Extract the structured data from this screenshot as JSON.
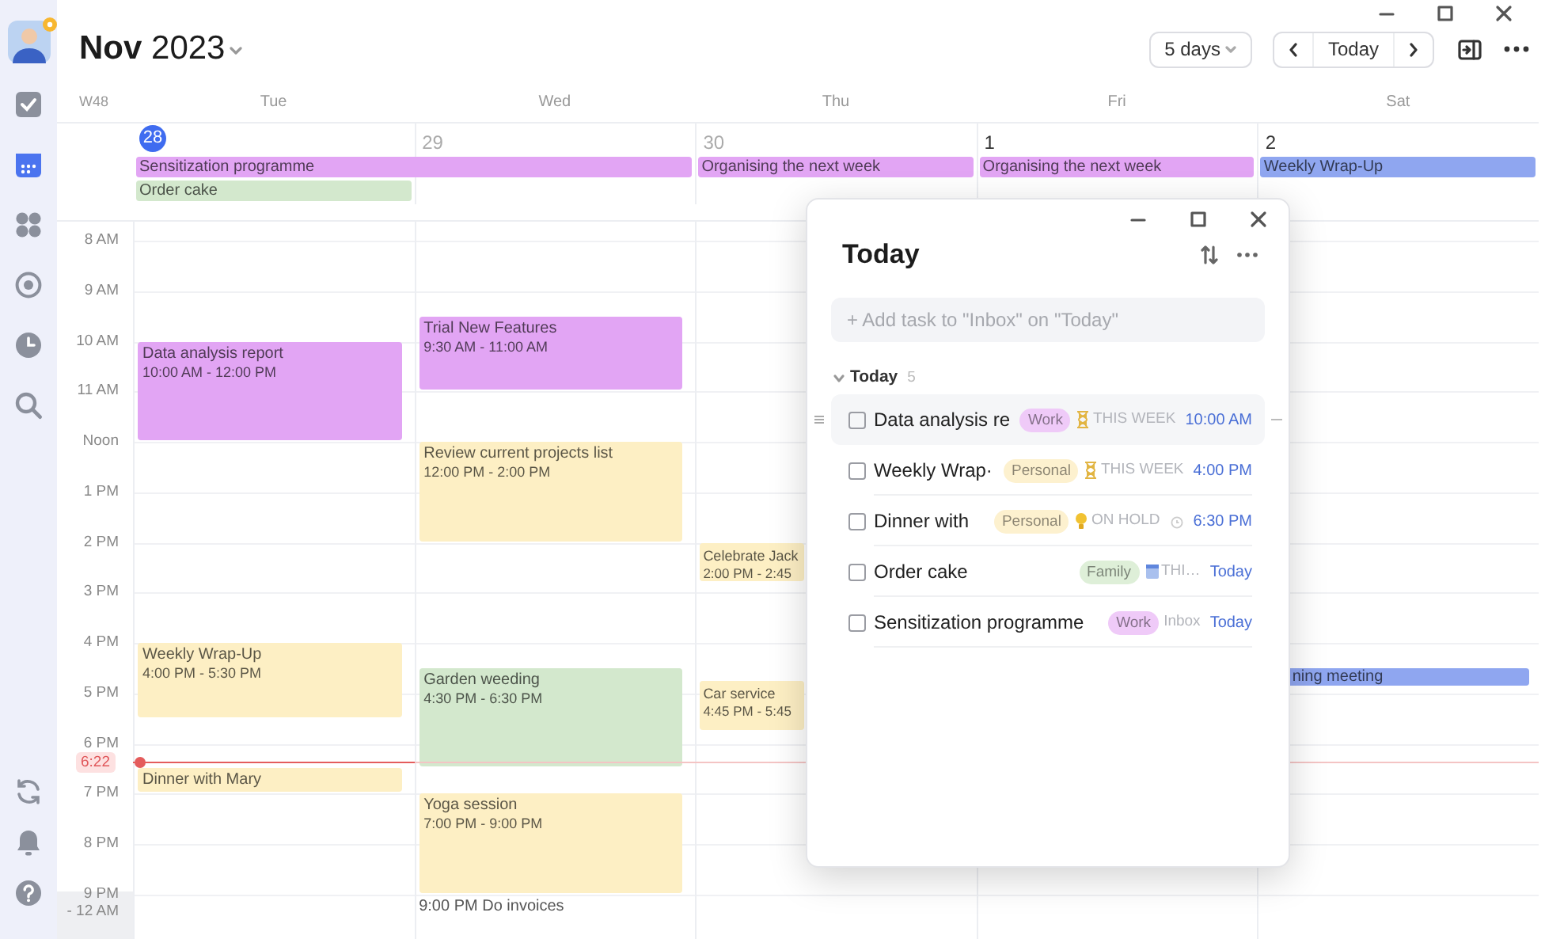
{
  "header": {
    "title": "**Nov** 2023",
    "view": "5 days",
    "today_button": "Today"
  },
  "sidebar": {
    "items": [
      {
        "kind": "tasks",
        "selected": false
      },
      {
        "kind": "calendar",
        "selected": true
      },
      {
        "kind": "apps",
        "selected": false
      },
      {
        "kind": "focus",
        "selected": false
      },
      {
        "kind": "clock",
        "selected": false
      },
      {
        "kind": "search",
        "selected": false
      }
    ],
    "footer": [
      {
        "kind": "sync"
      },
      {
        "kind": "bell"
      },
      {
        "kind": "help"
      }
    ]
  },
  "week_label": "W48",
  "days": [
    {
      "weekday": "Tue",
      "date": "28",
      "today": true,
      "dimmed": false,
      "events": [
        {
          "kind": "block",
          "title": "Data analysis report",
          "time": "10:00 AM - 12:00 PM",
          "color": "#e2a5f4"
        },
        {
          "kind": "block",
          "title": "Weekly Wrap-Up",
          "time": "4:00 PM - 5:30 PM",
          "color": "#fdefc4"
        },
        {
          "kind": "block",
          "title": "Dinner with Mary",
          "color": "#fdefc4"
        }
      ]
    },
    {
      "weekday": "Wed",
      "date": "29",
      "today": false,
      "dimmed": true,
      "events": [
        {
          "kind": "block",
          "title": "Trial New Features",
          "time": "9:30 AM - 11:00 AM",
          "color": "#e2a5f4"
        },
        {
          "kind": "block",
          "title": "Review current projects list",
          "time": "12:00 PM - 2:00 PM",
          "color": "#fdefc4"
        },
        {
          "kind": "block",
          "title": "Garden weeding",
          "time": "4:30 PM - 6:30 PM",
          "color": "#d3e8cd"
        },
        {
          "kind": "block",
          "title": "Yoga session",
          "time": "7:00 PM - 9:00 PM",
          "color": "#fdefc4"
        },
        {
          "kind": "text",
          "title": "9:00 PM Do invoices"
        }
      ]
    },
    {
      "weekday": "Thu",
      "date": "30",
      "today": false,
      "dimmed": true,
      "events": [
        {
          "kind": "block",
          "title": "Celebrate Jack",
          "time": "2:00 PM - 2:45",
          "color": "#fdefc4"
        },
        {
          "kind": "block",
          "title": "Car service",
          "time": "4:45 PM - 5:45",
          "color": "#fdefc4"
        }
      ]
    },
    {
      "weekday": "Fri",
      "date": "1",
      "today": false,
      "dimmed": false
    },
    {
      "weekday": "Sat",
      "date": "2",
      "today": false,
      "dimmed": false,
      "events": [
        {
          "kind": "bar",
          "title": "ning meeting",
          "color": "#8fa6f0"
        }
      ]
    }
  ],
  "all_day": [
    {
      "title": "Sensitization programme",
      "color": "#e2a5f4"
    },
    {
      "title": "Order cake",
      "color": "#d3e8cd"
    },
    {
      "title": "Organising the next week",
      "color": "#e2a5f4"
    },
    {
      "title": "Organising the next week",
      "color": "#e2a5f4"
    },
    {
      "title": "Weekly Wrap-Up",
      "color": "#8fa6f0"
    }
  ],
  "hours": [
    "8 AM",
    "9 AM",
    "10 AM",
    "11 AM",
    "Noon",
    "1 PM",
    "2 PM",
    "3 PM",
    "4 PM",
    "5 PM",
    "6 PM",
    "7 PM",
    "8 PM",
    "9 PM\n- 12 AM"
  ],
  "now": "6:22",
  "today_panel": {
    "title": "Today",
    "add_placeholder": "+ Add task to \"Inbox\" on \"Today\"",
    "section": {
      "title": "Today",
      "count": "5",
      "expanded": true
    },
    "tasks": [
      {
        "title": "Data analysis re",
        "checked": false,
        "hovered": true,
        "tag": {
          "label": "Work",
          "color": "#efcaf8"
        },
        "meta": {
          "kind": "hourglass",
          "label": "THIS WEEK"
        },
        "reminder": false,
        "due": "10:00 AM"
      },
      {
        "title": "Weekly Wrap·",
        "checked": false,
        "hovered": false,
        "tag": {
          "label": "Personal",
          "color": "#fdf1cf"
        },
        "meta": {
          "kind": "hourglass",
          "label": "THIS WEEK"
        },
        "reminder": false,
        "due": "4:00 PM"
      },
      {
        "title": "Dinner with",
        "checked": false,
        "hovered": false,
        "tag": {
          "label": "Personal",
          "color": "#fdf1cf"
        },
        "meta": {
          "kind": "bulb",
          "label": "ON HOLD"
        },
        "reminder": true,
        "due": "6:30 PM"
      },
      {
        "title": "Order cake",
        "checked": false,
        "hovered": false,
        "tag": {
          "label": "Family",
          "color": "#deefd8"
        },
        "meta": {
          "kind": "calendar",
          "label": "THI…"
        },
        "reminder": false,
        "due": "Today"
      },
      {
        "title": "Sensitization programme",
        "checked": false,
        "hovered": false,
        "tag": {
          "label": "Work",
          "color": "#efcaf8"
        },
        "meta": {
          "kind": "plain",
          "label": "Inbox"
        },
        "reminder": false,
        "due": "Today"
      }
    ]
  }
}
